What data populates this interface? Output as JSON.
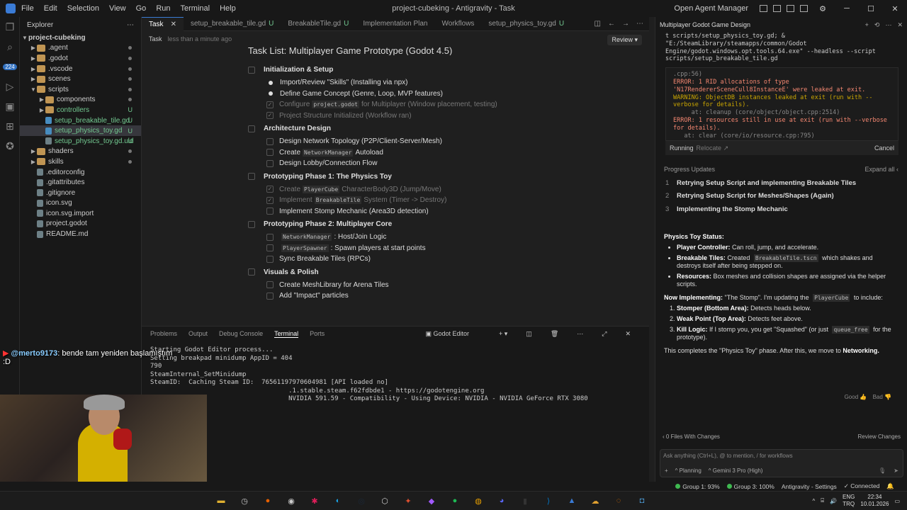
{
  "window": {
    "title": "project-cubeking - Antigravity - Task",
    "menu": [
      "File",
      "Edit",
      "Selection",
      "View",
      "Go",
      "Run",
      "Terminal",
      "Help"
    ],
    "open_agent_manager": "Open Agent Manager"
  },
  "activity": {
    "badge": "224"
  },
  "explorer": {
    "header": "Explorer",
    "root": "project-cubeking",
    "items": [
      {
        "name": ".agent",
        "level": 1,
        "folder": true
      },
      {
        "name": ".godot",
        "level": 1,
        "folder": true
      },
      {
        "name": ".vscode",
        "level": 1,
        "folder": true
      },
      {
        "name": "scenes",
        "level": 1,
        "folder": true
      },
      {
        "name": "scripts",
        "level": 1,
        "folder": true,
        "open": true
      },
      {
        "name": "components",
        "level": 2,
        "folder": true
      },
      {
        "name": "controllers",
        "level": 2,
        "folder": true,
        "status": "U"
      },
      {
        "name": "setup_breakable_tile.gd",
        "level": 2,
        "status": "U"
      },
      {
        "name": "setup_physics_toy.gd",
        "level": 2,
        "status": "U",
        "selected": true
      },
      {
        "name": "setup_physics_toy.gd.uid",
        "level": 2,
        "status": "U"
      },
      {
        "name": "shaders",
        "level": 1,
        "folder": true
      },
      {
        "name": "skills",
        "level": 1,
        "folder": true
      },
      {
        "name": ".editorconfig",
        "level": 1
      },
      {
        "name": ".gitattributes",
        "level": 1
      },
      {
        "name": ".gitignore",
        "level": 1
      },
      {
        "name": "icon.svg",
        "level": 1
      },
      {
        "name": "icon.svg.import",
        "level": 1
      },
      {
        "name": "project.godot",
        "level": 1
      },
      {
        "name": "README.md",
        "level": 1
      }
    ]
  },
  "tabs": [
    {
      "label": "Task",
      "active": true
    },
    {
      "label": "setup_breakable_tile.gd",
      "status": "U"
    },
    {
      "label": "BreakableTile.gd",
      "status": "U"
    },
    {
      "label": "Implementation Plan"
    },
    {
      "label": "Workflows"
    },
    {
      "label": "setup_physics_toy.gd",
      "status": "U"
    }
  ],
  "task": {
    "label": "Task",
    "meta": "less than a minute ago",
    "review": "Review",
    "title": "Task List: Multiplayer Game Prototype (Godot 4.5)",
    "sections": [
      {
        "title": "Initialization & Setup",
        "items": [
          {
            "text": "Import/Review \"Skills\" (Installing via npx)",
            "state": "active"
          },
          {
            "text": "Define Game Concept (Genre, Loop, MVP features)",
            "state": "active"
          },
          {
            "pre": "Configure ",
            "code": "project.godot",
            "post": " for Multiplayer (Window placement, testing)",
            "state": "done"
          },
          {
            "text": "Project Structure Initialized (Workflow ran)",
            "state": "done"
          }
        ]
      },
      {
        "title": "Architecture Design",
        "items": [
          {
            "text": "Design Network Topology (P2P/Client-Server/Mesh)",
            "state": "todo"
          },
          {
            "pre": "Create ",
            "code": "NetworkManager",
            "post": " Autoload",
            "state": "todo"
          },
          {
            "text": "Design Lobby/Connection Flow",
            "state": "todo"
          }
        ]
      },
      {
        "title": "Prototyping Phase 1: The Physics Toy",
        "items": [
          {
            "pre": "Create ",
            "code": "PlayerCube",
            "post": " CharacterBody3D (Jump/Move)",
            "state": "done"
          },
          {
            "pre": "Implement ",
            "code": "BreakableTile",
            "post": " System (Timer -> Destroy)",
            "state": "done"
          },
          {
            "text": "Implement Stomp Mechanic (Area3D detection)",
            "state": "todo"
          }
        ]
      },
      {
        "title": "Prototyping Phase 2: Multiplayer Core",
        "items": [
          {
            "pre": "",
            "code": "NetworkManager",
            "post": ": Host/Join Logic",
            "state": "todo"
          },
          {
            "pre": "",
            "code": "PlayerSpawner",
            "post": ": Spawn players at start points",
            "state": "todo"
          },
          {
            "text": "Sync Breakable Tiles (RPCs)",
            "state": "todo"
          }
        ]
      },
      {
        "title": "Visuals & Polish",
        "items": [
          {
            "text": "Create MeshLibrary for Arena Tiles",
            "state": "todo"
          },
          {
            "text": "Add \"Impact\" particles",
            "state": "todo"
          }
        ]
      }
    ]
  },
  "panel": {
    "tabs": [
      "Problems",
      "Output",
      "Debug Console",
      "Terminal",
      "Ports"
    ],
    "active": "Terminal",
    "godot": "Godot Editor",
    "lines": [
      "Starting Godot Editor process...",
      "Setting breakpad minidump AppID = 404",
      "790",
      "",
      "SteamInternal_SetMinidump",
      "SteamID:  Caching Steam ID:  76561197970604981 [API loaded no]",
      "",
      "                                    .1.stable.steam.f62fdbde1 - https://godotengine.org",
      "",
      "                                    NVIDIA 591.59 - Compatibility - Using Device: NVIDIA - NVIDIA GeForce RTX 3080"
    ]
  },
  "chat": {
    "user": "@merto9173",
    "message": "bende tam yeniden başlamıştım :D"
  },
  "agent": {
    "title": "Multiplayer Godot Game Design",
    "cmd": "t scripts/setup_physics_toy.gd; & \"E:/SteamLibrary/steamapps/common/Godot Engine/godot.windows.opt.tools.64.exe\" --headless --script scripts/setup_breakable_tile.gd",
    "output": [
      {
        "t": ".cpp:56)",
        "c": "dim"
      },
      {
        "t": "ERROR: 1 RID allocations of type 'N17RendererSceneCull8InstanceE' were leaked at exit.",
        "c": "err"
      },
      {
        "t": "WARNING: ObjectDB instances leaked at exit (run with --verbose for details).",
        "c": "warn"
      },
      {
        "t": "     at: cleanup (core/object/object.cpp:2514)",
        "c": "dim"
      },
      {
        "t": "ERROR: 1 resources still in use at exit (run with --verbose for details).",
        "c": "err"
      },
      {
        "t": "   at: clear (core/io/resource.cpp:795)",
        "c": "dim"
      }
    ],
    "running": "Running",
    "relocate": "Relocate",
    "cancel": "Cancel",
    "progress_title": "Progress Updates",
    "expand": "Expand all",
    "progress": [
      {
        "n": "1",
        "t": "Retrying Setup Script and implementing Breakable Tiles"
      },
      {
        "n": "2",
        "t": "Retrying Setup Script for Meshes/Shapes (Again)"
      },
      {
        "n": "3",
        "t": "Implementing the Stomp Mechanic"
      }
    ],
    "status_title": "Physics Toy Status:",
    "status_items": [
      {
        "b": "Player Controller:",
        "t": " Can roll, jump, and accelerate."
      },
      {
        "b": "Breakable Tiles:",
        "t": " Created ",
        "code": "BreakableTile.tscn",
        "t2": " which shakes and destroys itself after being stepped on."
      },
      {
        "b": "Resources:",
        "t": " Box meshes and collision shapes are assigned via the helper scripts."
      }
    ],
    "now_b": "Now Implementing:",
    "now_t": " \"The Stomp\". I'm updating the ",
    "now_code": "PlayerCube",
    "now_t2": " to include:",
    "steps": [
      {
        "b": "Stomper (Bottom Area):",
        "t": " Detects heads below."
      },
      {
        "b": "Weak Point (Top Area):",
        "t": " Detects feet above."
      },
      {
        "b": "Kill Logic:",
        "t": " If I stomp you, you get \"Squashed\" (or just ",
        "code": "queue_free",
        "t2": " for the prototype)."
      }
    ],
    "closing_t": "This completes the \"Physics Toy\" phase. After this, we move to ",
    "closing_b": "Networking.",
    "good": "Good",
    "bad": "Bad",
    "files": "0 Files With Changes",
    "review_changes": "Review Changes",
    "ask_placeholder": "Ask anything (Ctrl+L), @ to mention, / for workflows",
    "mode": "Planning",
    "model": "Gemini 3 Pro (High)"
  },
  "statusbar": {
    "group1": "Group 1: 93%",
    "group3": "Group 3: 100%",
    "settings": "Antigravity - Settings",
    "connected": "Connected"
  },
  "taskbar": {
    "lang1": "ENG",
    "lang2": "TRQ",
    "time": "22:34",
    "date": "10.01.2026"
  }
}
